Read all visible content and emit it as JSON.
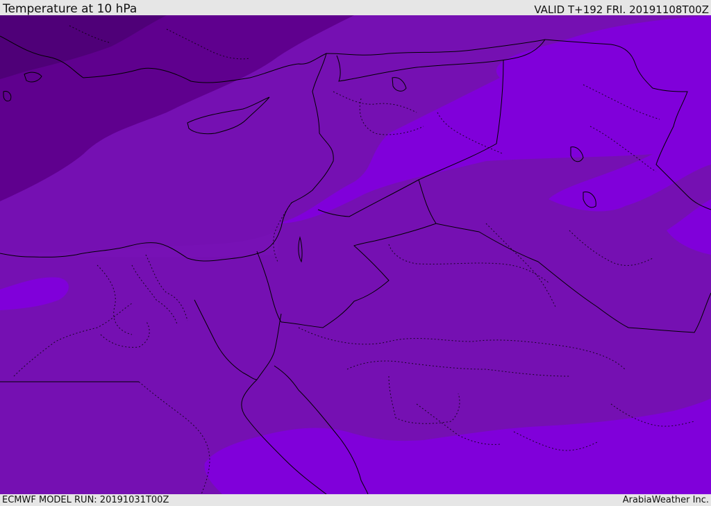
{
  "header": {
    "title": "Temperature at 10 hPa",
    "valid": "VALID T+192 FRI. 20191108T00Z"
  },
  "footer": {
    "model_run": "ECMWF MODEL RUN: 20191031T00Z",
    "credit": "ArabiaWeather Inc."
  },
  "map": {
    "colors": {
      "band_darkest": "#4f0078",
      "band_dark": "#5f008e",
      "band_mid": "#7510b2",
      "band_mid_alt": "#7712b6",
      "band_light": "#8000da",
      "coastline": "#000000",
      "border": "#000000"
    }
  }
}
